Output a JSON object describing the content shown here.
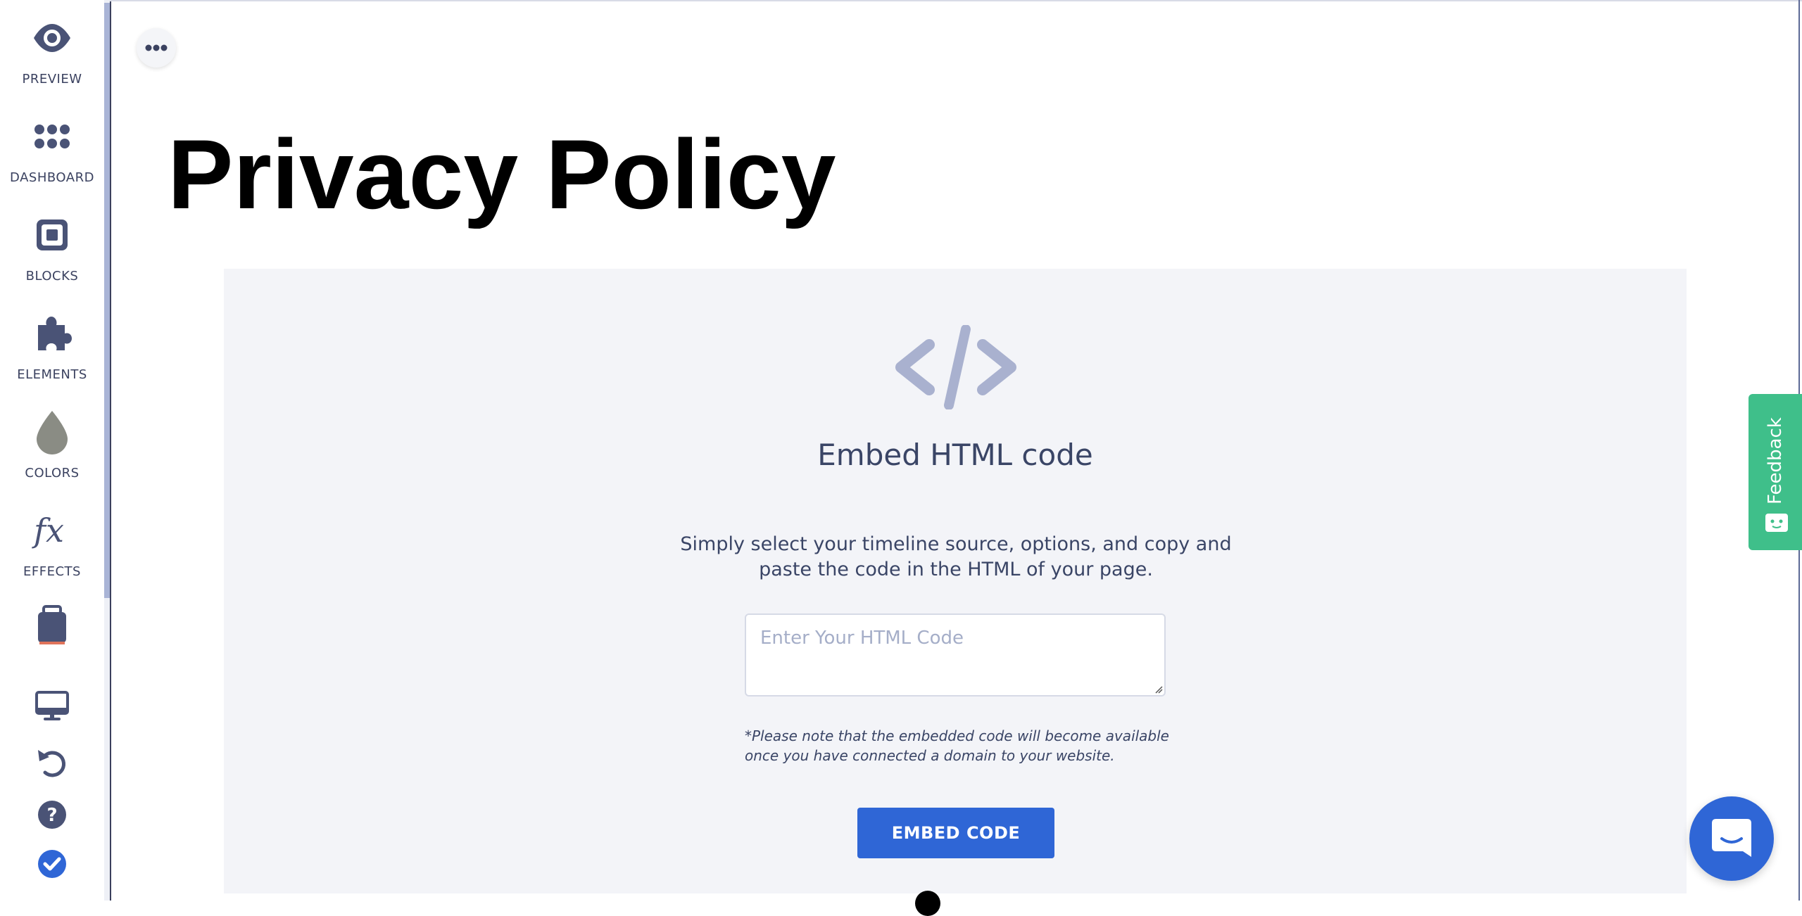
{
  "sidebar": {
    "items": [
      {
        "label": "PREVIEW",
        "icon": "eye-icon"
      },
      {
        "label": "DASHBOARD",
        "icon": "grid-dots-icon"
      },
      {
        "label": "BLOCKS",
        "icon": "block-icon"
      },
      {
        "label": "ELEMENTS",
        "icon": "puzzle-icon"
      },
      {
        "label": "COLORS",
        "icon": "drop-icon"
      },
      {
        "label": "EFFECTS",
        "icon": "fx-icon"
      }
    ],
    "extra_icon": "briefcase-icon",
    "tools": [
      {
        "name": "desktop-icon"
      },
      {
        "name": "undo-icon"
      },
      {
        "name": "help-icon"
      },
      {
        "name": "publish-check-icon"
      }
    ]
  },
  "page": {
    "title": "Privacy Policy"
  },
  "embed": {
    "icon": "code-icon",
    "heading": "Embed HTML code",
    "description": "Simply select your timeline source, options, and copy and paste the code in the HTML of your page.",
    "input_value": "",
    "input_placeholder": "Enter Your HTML Code",
    "note": "*Please note that the embedded code will become available once you have connected a domain to your website.",
    "button_label": "EMBED CODE"
  },
  "feedback": {
    "label": "Feedback"
  },
  "colors": {
    "accent": "#2f66d6",
    "feedback": "#3fbf8a",
    "sidebar_icon": "#4a5376",
    "block_bg": "#f3f4f8"
  }
}
